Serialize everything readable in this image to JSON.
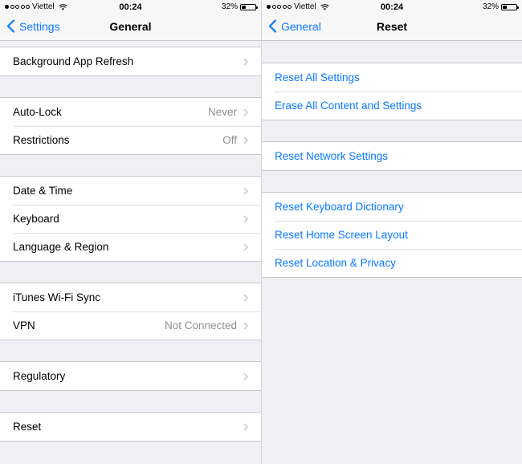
{
  "left": {
    "status": {
      "carrier": "Viettel",
      "time": "00:24",
      "battery": "32%",
      "battery_level": 0.32
    },
    "nav": {
      "back_label": "Settings",
      "title": "General"
    },
    "groups": [
      [
        {
          "label": "Background App Refresh",
          "value": ""
        }
      ],
      [
        {
          "label": "Auto-Lock",
          "value": "Never"
        },
        {
          "label": "Restrictions",
          "value": "Off"
        }
      ],
      [
        {
          "label": "Date & Time",
          "value": ""
        },
        {
          "label": "Keyboard",
          "value": ""
        },
        {
          "label": "Language & Region",
          "value": ""
        }
      ],
      [
        {
          "label": "iTunes Wi-Fi Sync",
          "value": ""
        },
        {
          "label": "VPN",
          "value": "Not Connected"
        }
      ],
      [
        {
          "label": "Regulatory",
          "value": ""
        }
      ],
      [
        {
          "label": "Reset",
          "value": ""
        }
      ]
    ]
  },
  "right": {
    "status": {
      "carrier": "Viettel",
      "time": "00:24",
      "battery": "32%",
      "battery_level": 0.32
    },
    "nav": {
      "back_label": "General",
      "title": "Reset"
    },
    "groups": [
      [
        {
          "label": "Reset All Settings"
        },
        {
          "label": "Erase All Content and Settings"
        }
      ],
      [
        {
          "label": "Reset Network Settings"
        }
      ],
      [
        {
          "label": "Reset Keyboard Dictionary"
        },
        {
          "label": "Reset Home Screen Layout"
        },
        {
          "label": "Reset Location & Privacy"
        }
      ]
    ]
  },
  "colors": {
    "accent": "#0a7aff",
    "background": "#efeff4",
    "secondary_text": "#8e8e93",
    "separator": "#c8c7cc"
  },
  "icons": {
    "back": "chevron-left-icon",
    "disclosure": "chevron-right-icon",
    "wifi": "wifi-icon",
    "battery": "battery-icon",
    "signal": "signal-dots-icon"
  }
}
